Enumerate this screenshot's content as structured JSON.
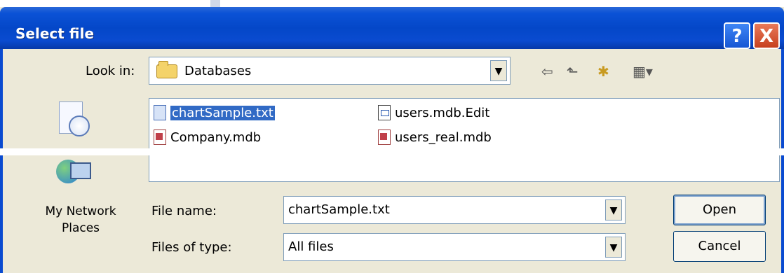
{
  "window": {
    "title": "Select file"
  },
  "titlebar_buttons": {
    "help": "?",
    "close": "X"
  },
  "look_in": {
    "label": "Look in:",
    "value": "Databases"
  },
  "toolbar": {
    "back": "⇦",
    "up": "⬑",
    "new_folder": "✱",
    "view_menu": "▦▾"
  },
  "places": [
    {
      "name": "Recent",
      "label": ""
    },
    {
      "name": "My Network Places",
      "label": "My Network Places"
    }
  ],
  "files": [
    {
      "name": "chartSample.txt",
      "type": "txt",
      "selected": true
    },
    {
      "name": "Company.mdb",
      "type": "mdb",
      "selected": false
    },
    {
      "name": "users.mdb.Edit",
      "type": "edit",
      "selected": false
    },
    {
      "name": "users_real.mdb",
      "type": "mdb",
      "selected": false
    }
  ],
  "file_name": {
    "label": "File name:",
    "value": "chartSample.txt"
  },
  "file_type": {
    "label": "Files of type:",
    "value": "All files"
  },
  "buttons": {
    "open": "Open",
    "cancel": "Cancel"
  },
  "colors": {
    "titlebar": "#0a4bd0",
    "selection": "#316ac5",
    "dialog_bg": "#ece9d8"
  }
}
